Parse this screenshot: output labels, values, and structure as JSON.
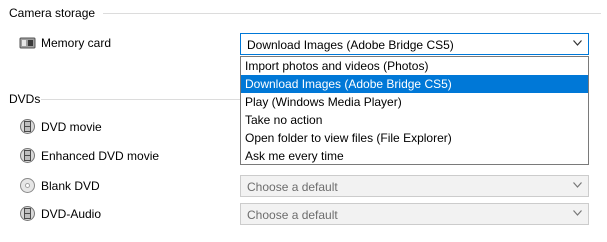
{
  "camera_storage": {
    "title": "Camera storage",
    "memory_card": {
      "label": "Memory card",
      "selected": "Download Images (Adobe Bridge CS5)",
      "options": [
        "Import photos and videos (Photos)",
        "Download Images (Adobe Bridge CS5)",
        "Play (Windows Media Player)",
        "Take no action",
        "Open folder to view files (File Explorer)",
        "Ask me every time"
      ],
      "highlighted_index": 1
    }
  },
  "dvds": {
    "title": "DVDs",
    "items": [
      {
        "label": "DVD movie",
        "icon": "film-disc-icon"
      },
      {
        "label": "Enhanced DVD movie",
        "icon": "film-disc-icon"
      },
      {
        "label": "Blank DVD",
        "icon": "blank-disc-icon",
        "value": "Choose a default"
      },
      {
        "label": "DVD-Audio",
        "icon": "film-disc-icon",
        "value": "Choose a default"
      }
    ]
  },
  "colors": {
    "accent": "#0078d7",
    "border": "#b4b4b4",
    "disabled_bg": "#f2f2f2",
    "disabled_text": "#6d6d6d"
  }
}
